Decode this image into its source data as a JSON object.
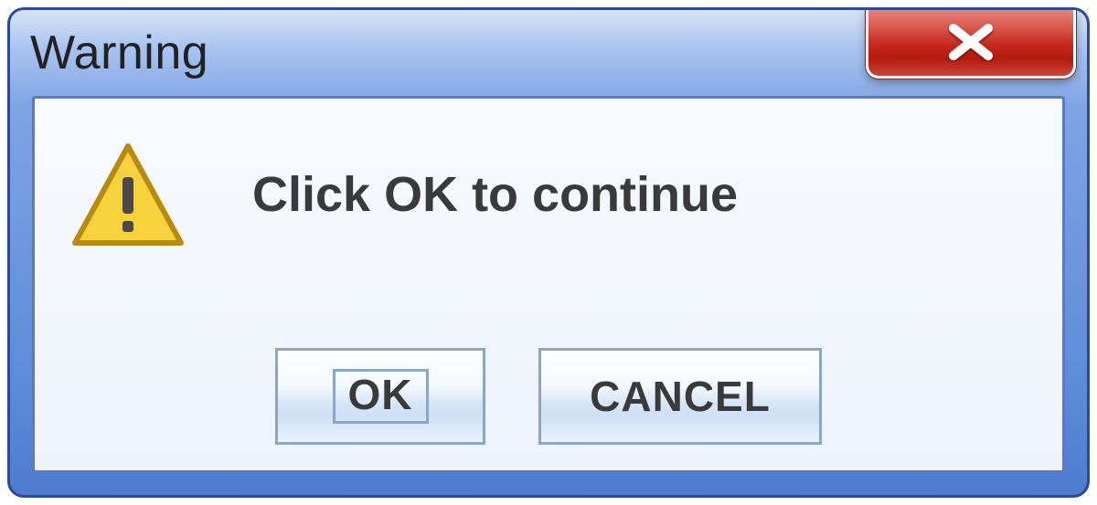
{
  "dialog": {
    "title": "Warning",
    "message": "Click OK to continue",
    "buttons": {
      "ok": "OK",
      "cancel": "CANCEL"
    }
  }
}
